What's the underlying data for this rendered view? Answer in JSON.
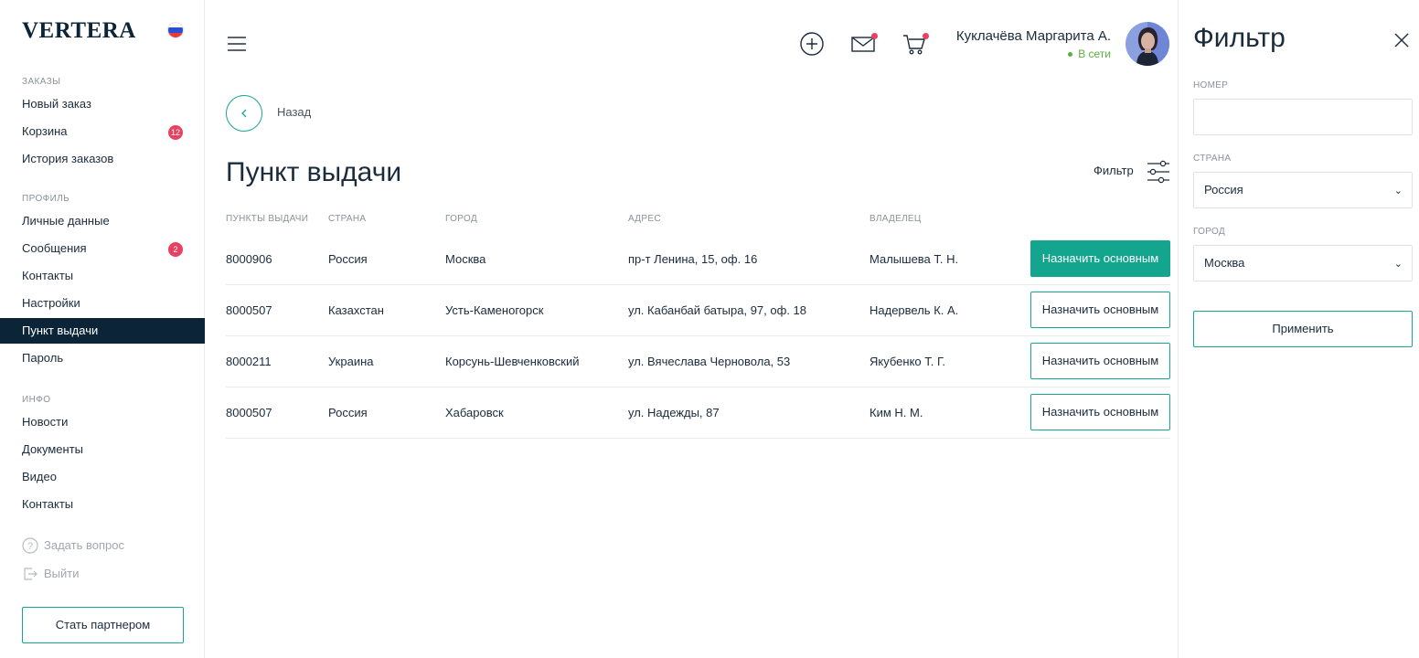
{
  "brand": {
    "logo_text": "VERTERA"
  },
  "sidebar": {
    "sections": [
      {
        "title": "ЗАКАЗЫ"
      },
      {
        "title": "ПРОФИЛЬ"
      },
      {
        "title": "ИНФО"
      }
    ],
    "items": [
      {
        "label": "Новый заказ"
      },
      {
        "label": "Корзина",
        "badge": "12"
      },
      {
        "label": "История заказов"
      },
      {
        "label": "Личные данные"
      },
      {
        "label": "Сообщения",
        "badge": "2"
      },
      {
        "label": "Контакты"
      },
      {
        "label": "Настройки"
      },
      {
        "label": "Пункт выдачи",
        "active": true
      },
      {
        "label": "Пароль"
      },
      {
        "label": "Новости"
      },
      {
        "label": "Документы"
      },
      {
        "label": "Видео"
      },
      {
        "label": "Контакты"
      }
    ],
    "ask_question": "Задать вопрос",
    "logout": "Выйти",
    "partner_button": "Стать партнером"
  },
  "header": {
    "icons": [
      "menu-icon",
      "add-circle-icon",
      "mail-icon",
      "cart-icon"
    ],
    "user_name": "Куклачёва Маргарита А.",
    "user_status": "В сети"
  },
  "main": {
    "back_label": "Назад",
    "page_title": "Пункт выдачи",
    "filter_label": "Фильтр",
    "columns": [
      "ПУНКТЫ ВЫДАЧИ",
      "СТРАНА",
      "ГОРОД",
      "АДРЕС",
      "ВЛАДЕЛЕЦ"
    ],
    "rows": [
      {
        "id": "8000906",
        "country": "Россия",
        "city": "Москва",
        "address": "пр-т Ленина, 15, оф. 16",
        "owner": "Малышева Т. Н.",
        "action": "Назначить основным",
        "primary": true
      },
      {
        "id": "8000507",
        "country": "Казахстан",
        "city": "Усть-Каменогорск",
        "address": "ул. Кабанбай батыра, 97, оф. 18",
        "owner": "Надервель К. А.",
        "action": "Назначить основным",
        "primary": false
      },
      {
        "id": "8000211",
        "country": "Украина",
        "city": "Корсунь-Шевченковский",
        "address": "ул. Вячеслава Черновола, 53",
        "owner": "Якубенко Т. Г.",
        "action": "Назначить основным",
        "primary": false
      },
      {
        "id": "8000507",
        "country": "Россия",
        "city": "Хабаровск",
        "address": "ул. Надежды, 87",
        "owner": "Ким Н. М.",
        "action": "Назначить основным",
        "primary": false
      }
    ]
  },
  "filter_panel": {
    "title": "Фильтр",
    "number_label": "НОМЕР",
    "number_value": "",
    "country_label": "СТРАНА",
    "country_value": "Россия",
    "city_label": "ГОРОД",
    "city_value": "Москва",
    "apply_button": "Применить"
  },
  "colors": {
    "accent": "#13a58d",
    "navy": "#0b2438",
    "badge": "#e84261",
    "online": "#5aaf3c"
  }
}
